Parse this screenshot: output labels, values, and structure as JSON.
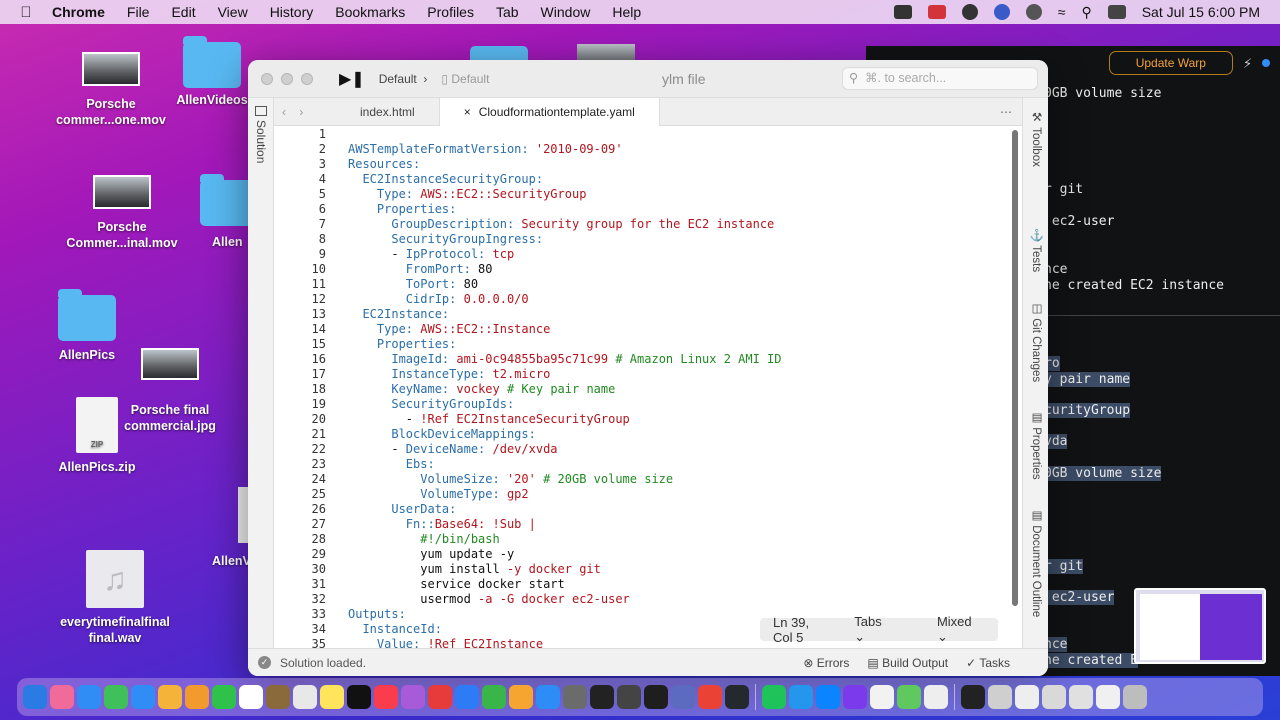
{
  "menubar": {
    "app": "Chrome",
    "items": [
      "File",
      "Edit",
      "View",
      "History",
      "Bookmarks",
      "Profiles",
      "Tab",
      "Window",
      "Help"
    ],
    "clock": "Sat Jul 15  6:00 PM"
  },
  "desktop": {
    "icons": [
      {
        "label": "Porsche commer...one.mov"
      },
      {
        "label": "AllenVideos"
      },
      {
        "label": "Porsche Commer...inal.mov"
      },
      {
        "label": "Allen"
      },
      {
        "label": "AllenPics"
      },
      {
        "label": "Porsche final commercial.jpg"
      },
      {
        "label": "AllenPics.zip"
      },
      {
        "label": "AllenV"
      },
      {
        "label": "everytimefinalfinal final.wav"
      }
    ],
    "zip_badge": "ZIP"
  },
  "warp": {
    "update_label": "Update Warp",
    "lines": [
      {
        "text": "0GB volume size",
        "hl": false
      },
      {
        "text": "r git",
        "hl": false
      },
      {
        "text": " ec2-user",
        "hl": false
      },
      {
        "text": "nce",
        "hl": false
      },
      {
        "text": "he created EC2 instance",
        "hl": false
      },
      {
        "text": "ro",
        "hl": true
      },
      {
        "text": "y pair name",
        "hl": true
      },
      {
        "text": "curityGroup",
        "hl": true
      },
      {
        "text": "vda",
        "hl": true
      },
      {
        "text": "0GB volume size",
        "hl": true
      },
      {
        "text": "r git",
        "hl": true
      },
      {
        "text": " ec2-user",
        "hl": true
      },
      {
        "text": "nce",
        "hl": true
      },
      {
        "text": "he created E",
        "hl": true
      }
    ]
  },
  "ide": {
    "breadcrumb1": "Default",
    "breadcrumb2": "Default",
    "window_title": "ylm file",
    "search_placeholder": "⌘. to search...",
    "left_panel": "Solution",
    "right_panels": [
      "Toolbox",
      "Tests",
      "Git Changes",
      "Properties",
      "Document Outline"
    ],
    "tabs": [
      {
        "label": "index.html",
        "active": false
      },
      {
        "label": "Cloudformationtemplate.yaml",
        "active": true
      }
    ],
    "line_numbers": [
      "1",
      "2",
      "3",
      "4",
      "5",
      "6",
      "7",
      "8",
      "9",
      "10",
      "11",
      "12",
      "13",
      "14",
      "15",
      "16",
      "17",
      "18",
      "19",
      "20",
      "21",
      "22",
      "23",
      "24",
      "25",
      "26",
      "27",
      "28",
      "29",
      "30",
      "31",
      "32",
      "33",
      "34",
      "35"
    ],
    "code": [
      [],
      [
        [
          "k",
          "AWSTemplateFormatVersion: "
        ],
        [
          "s",
          "'2010-09-09'"
        ]
      ],
      [
        [
          "k",
          "Resources:"
        ]
      ],
      [
        [
          "n",
          "  "
        ],
        [
          "k",
          "EC2InstanceSecurityGroup:"
        ]
      ],
      [
        [
          "n",
          "    "
        ],
        [
          "k",
          "Type: "
        ],
        [
          "s",
          "AWS::EC2::SecurityGroup"
        ]
      ],
      [
        [
          "n",
          "    "
        ],
        [
          "k",
          "Properties:"
        ]
      ],
      [
        [
          "n",
          "      "
        ],
        [
          "k",
          "GroupDescription: "
        ],
        [
          "s",
          "Security group for the EC2 instance"
        ]
      ],
      [
        [
          "n",
          "      "
        ],
        [
          "k",
          "SecurityGroupIngress:"
        ]
      ],
      [
        [
          "n",
          "      - "
        ],
        [
          "k",
          "IpProtocol: "
        ],
        [
          "s",
          "tcp"
        ]
      ],
      [
        [
          "n",
          "        "
        ],
        [
          "k",
          "FromPort: "
        ],
        [
          "n",
          "80"
        ]
      ],
      [
        [
          "n",
          "        "
        ],
        [
          "k",
          "ToPort: "
        ],
        [
          "n",
          "80"
        ]
      ],
      [
        [
          "n",
          "        "
        ],
        [
          "k",
          "CidrIp: "
        ],
        [
          "s",
          "0.0.0.0/0"
        ]
      ],
      [
        [
          "n",
          "  "
        ],
        [
          "k",
          "EC2Instance:"
        ]
      ],
      [
        [
          "n",
          "    "
        ],
        [
          "k",
          "Type: "
        ],
        [
          "s",
          "AWS::EC2::Instance"
        ]
      ],
      [
        [
          "n",
          "    "
        ],
        [
          "k",
          "Properties:"
        ]
      ],
      [
        [
          "n",
          "      "
        ],
        [
          "k",
          "ImageId: "
        ],
        [
          "s",
          "ami-0c94855ba95c71c99 "
        ],
        [
          "c",
          "# Amazon Linux 2 AMI ID"
        ]
      ],
      [
        [
          "n",
          "      "
        ],
        [
          "k",
          "InstanceType: "
        ],
        [
          "s",
          "t2.micro"
        ]
      ],
      [
        [
          "n",
          "      "
        ],
        [
          "k",
          "KeyName: "
        ],
        [
          "s",
          "vockey "
        ],
        [
          "c",
          "# Key pair name"
        ]
      ],
      [
        [
          "n",
          "      "
        ],
        [
          "k",
          "SecurityGroupIds:"
        ]
      ],
      [
        [
          "n",
          "        - "
        ],
        [
          "s",
          "!Ref EC2InstanceSecurityGroup"
        ]
      ],
      [
        [
          "n",
          "      "
        ],
        [
          "k",
          "BlockDeviceMappings:"
        ]
      ],
      [
        [
          "n",
          "      - "
        ],
        [
          "k",
          "DeviceName: "
        ],
        [
          "s",
          "/dev/xvda"
        ]
      ],
      [
        [
          "n",
          "        "
        ],
        [
          "k",
          "Ebs:"
        ]
      ],
      [
        [
          "n",
          "          "
        ],
        [
          "k",
          "VolumeSize: "
        ],
        [
          "s",
          "'20' "
        ],
        [
          "c",
          "# 20GB volume size"
        ]
      ],
      [
        [
          "n",
          "          "
        ],
        [
          "k",
          "VolumeType: "
        ],
        [
          "s",
          "gp2"
        ]
      ],
      [
        [
          "n",
          "      "
        ],
        [
          "k",
          "UserData:"
        ]
      ],
      [
        [
          "n",
          "        "
        ],
        [
          "k",
          "Fn::"
        ],
        [
          "s",
          "Base64: !Sub |"
        ]
      ],
      [
        [
          "n",
          "          "
        ],
        [
          "c",
          "#!/bin/bash"
        ]
      ],
      [
        [
          "n",
          "          yum update -y"
        ]
      ],
      [
        [
          "n",
          "          yum install "
        ],
        [
          "s",
          "-y docker git"
        ]
      ],
      [
        [
          "n",
          "          service docker start"
        ]
      ],
      [
        [
          "n",
          "          usermod "
        ],
        [
          "s",
          "-a -G docker ec2-user"
        ]
      ],
      [
        [
          "k",
          "Outputs:"
        ]
      ],
      [
        [
          "n",
          "  "
        ],
        [
          "k",
          "InstanceId:"
        ]
      ],
      [
        [
          "n",
          "    "
        ],
        [
          "k",
          "Value: "
        ],
        [
          "s",
          "!Ref EC2Instance"
        ]
      ]
    ],
    "cursor_pos": "Ln 39, Col 5",
    "indent_mode": "Tabs",
    "line_endings": "Mixed",
    "status_message": "Solution loaded.",
    "bottom_tabs": [
      "Errors",
      "Build Output",
      "Tasks"
    ]
  },
  "dock": {
    "colors": [
      "#2a7be4",
      "#f06a9a",
      "#2f8df5",
      "#3fc05a",
      "#2f8df5",
      "#f6b33a",
      "#f29a2d",
      "#2fc24b",
      "#ffffff",
      "#8a6a3a",
      "#e8e8e8",
      "#ffe45c",
      "#111111",
      "#fa3c4c",
      "#a85bd8",
      "#e73b3b",
      "#2d7cf6",
      "#3ab54a",
      "#f7a531",
      "#2d8cf5",
      "#6b6b6b",
      "#222222",
      "#444444",
      "#1e1e1e",
      "#5c6bc0",
      "#ea4335",
      "#24292e",
      "#1ec45a",
      "#2496ed",
      "#0a84ff",
      "#7c3aed",
      "#f2f2f2",
      "#5fc95f",
      "#eeeeee",
      "#222222",
      "#cfcfcf",
      "#eeeeee",
      "#d9d9d9",
      "#e0e0e0",
      "#f0f0f0",
      "#bdbdbd"
    ]
  }
}
